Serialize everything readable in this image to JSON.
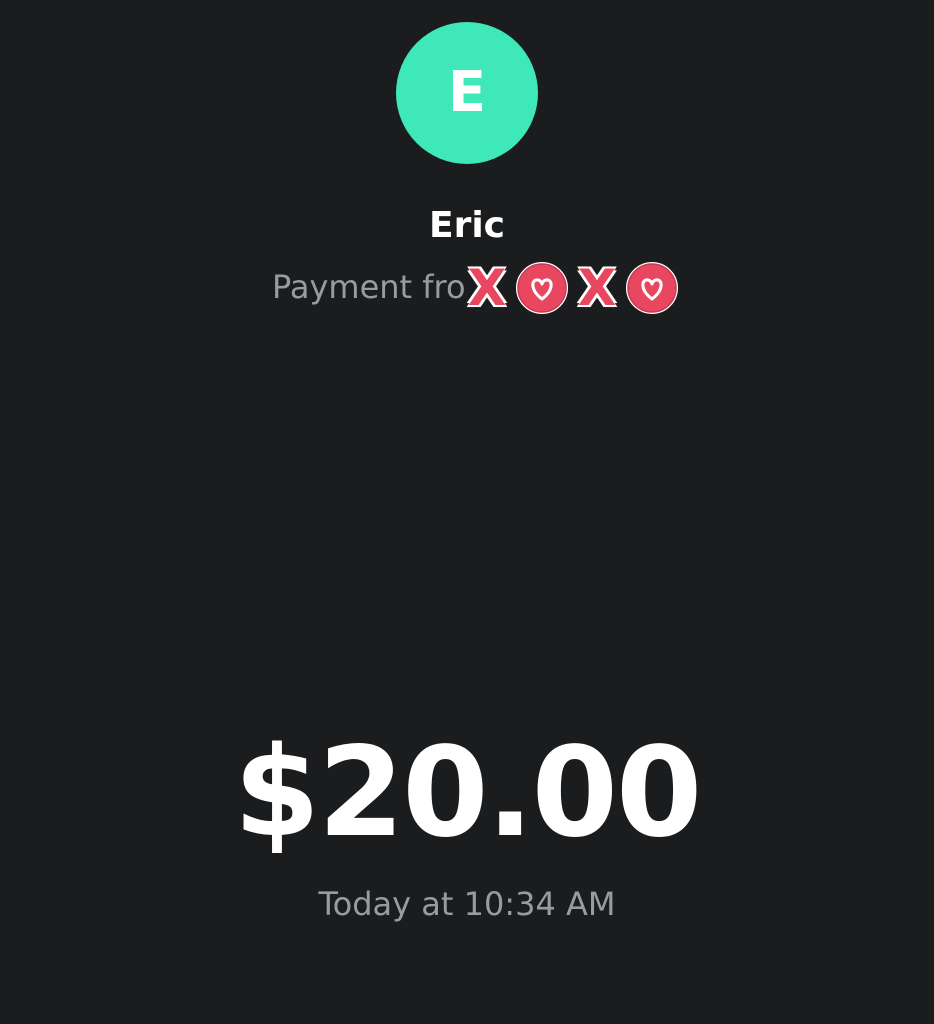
{
  "recipient": {
    "avatar_letter": "E",
    "avatar_color": "#3ee8b8",
    "name": "Eric"
  },
  "payment": {
    "description": "Payment fro",
    "sticker": "XOXO",
    "amount": "$20.00",
    "timestamp": "Today at 10:34 AM"
  },
  "colors": {
    "background": "#1b1c1e",
    "primary_text": "#ffffff",
    "secondary_text": "#9a9b9d",
    "sticker_red": "#e8475f"
  }
}
